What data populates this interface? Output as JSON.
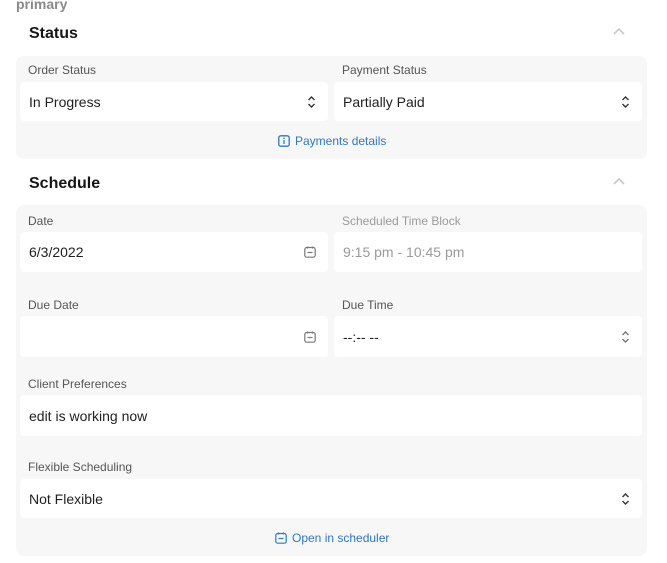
{
  "header": {
    "label": "primary"
  },
  "status": {
    "title": "Status",
    "order_status": {
      "label": "Order Status",
      "value": "In Progress"
    },
    "payment_status": {
      "label": "Payment Status",
      "value": "Partially Paid"
    },
    "payments_details_link": "Payments details"
  },
  "schedule": {
    "title": "Schedule",
    "date": {
      "label": "Date",
      "value": "6/3/2022"
    },
    "time_block": {
      "label": "Scheduled Time Block",
      "value": "9:15 pm - 10:45 pm"
    },
    "due_date": {
      "label": "Due Date",
      "value": ""
    },
    "due_time": {
      "label": "Due Time",
      "value": "--:-- --"
    },
    "client_preferences": {
      "label": "Client Preferences",
      "value": "edit is working now"
    },
    "flexible_scheduling": {
      "label": "Flexible Scheduling",
      "value": "Not Flexible"
    },
    "open_scheduler_link": "Open in scheduler"
  },
  "colors": {
    "link": "#2e77c7",
    "card_bg": "#f7f7f7",
    "muted_text": "#9a9a9a"
  }
}
